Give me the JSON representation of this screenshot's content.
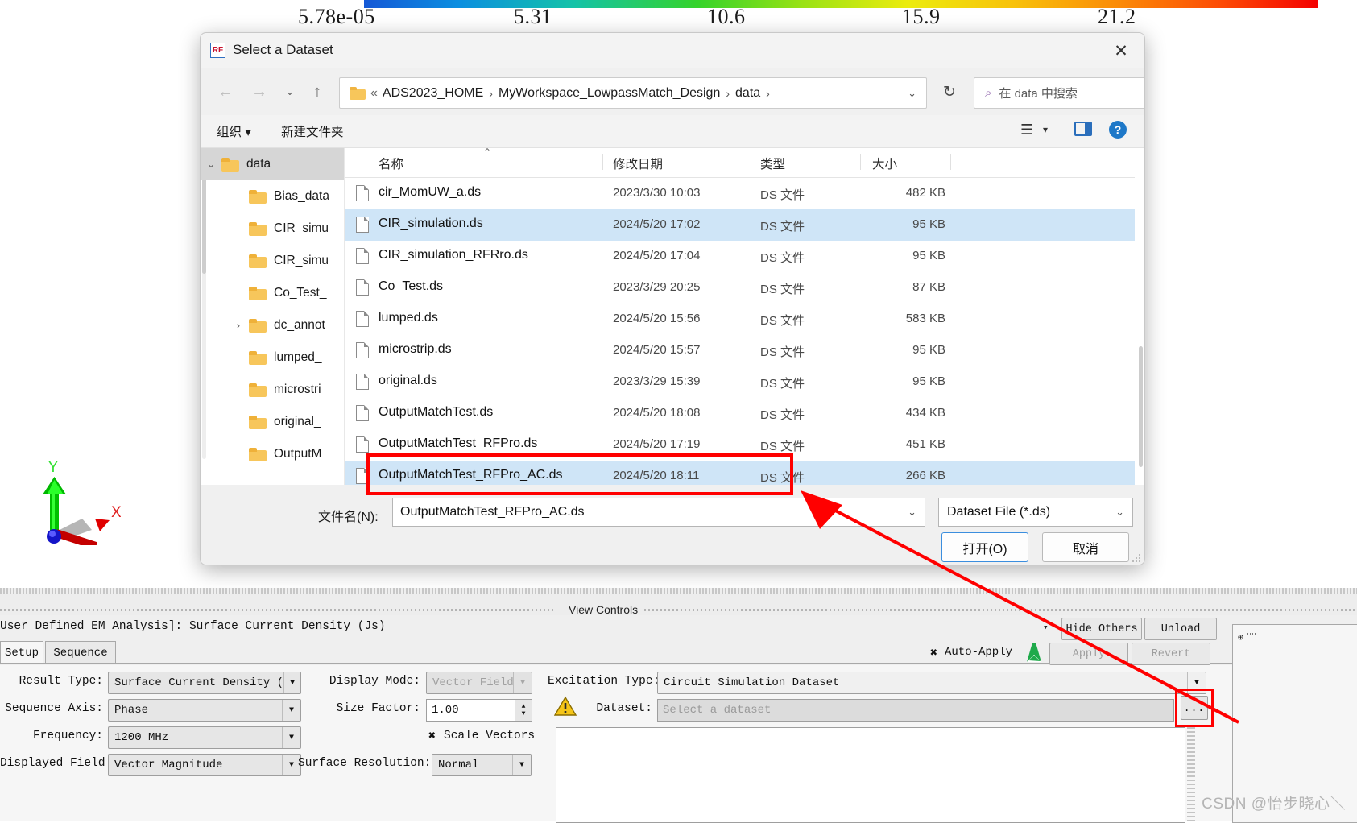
{
  "colorbar": {
    "ticks": [
      "5.78e-05",
      "5.31",
      "10.6",
      "15.9",
      "21.2"
    ]
  },
  "dialog": {
    "title": "Select a Dataset",
    "app_icon_text": "RF",
    "close_label": "✕",
    "nav": {
      "back": "←",
      "forward": "→",
      "recent": "⌄",
      "up": "↑",
      "refresh": "↻"
    },
    "address": {
      "leading": "«",
      "crumbs": [
        "ADS2023_HOME",
        "MyWorkspace_LowpassMatch_Design",
        "data"
      ],
      "separator": "›",
      "chevron": "⌄"
    },
    "search": {
      "placeholder": "在 data 中搜索",
      "icon": "⌕"
    },
    "toolbar": {
      "organize": "组织 ▾",
      "new_folder": "新建文件夹",
      "view_icon": "☰",
      "view_chevron": "▾",
      "help_icon": "?"
    },
    "tree": [
      {
        "label": "data",
        "twisty": "⌄",
        "selected": true,
        "indent": 26
      },
      {
        "label": "Bias_data",
        "twisty": "",
        "selected": false,
        "indent": 60
      },
      {
        "label": "CIR_simu",
        "twisty": "",
        "selected": false,
        "indent": 60
      },
      {
        "label": "CIR_simu",
        "twisty": "",
        "selected": false,
        "indent": 60
      },
      {
        "label": "Co_Test_",
        "twisty": "",
        "selected": false,
        "indent": 60
      },
      {
        "label": "dc_annot",
        "twisty": "›",
        "selected": false,
        "indent": 60
      },
      {
        "label": "lumped_",
        "twisty": "",
        "selected": false,
        "indent": 60
      },
      {
        "label": "microstri",
        "twisty": "",
        "selected": false,
        "indent": 60
      },
      {
        "label": "original_",
        "twisty": "",
        "selected": false,
        "indent": 60
      },
      {
        "label": "OutputM",
        "twisty": "",
        "selected": false,
        "indent": 60
      }
    ],
    "columns": {
      "name": "名称",
      "date": "修改日期",
      "type": "类型",
      "size": "大小",
      "sort_caret": "⌃"
    },
    "files": [
      {
        "name": "cir_MomUW_a.ds",
        "date": "2023/3/30 10:03",
        "type": "DS 文件",
        "size": "482 KB",
        "selected": false
      },
      {
        "name": "CIR_simulation.ds",
        "date": "2024/5/20 17:02",
        "type": "DS 文件",
        "size": "95 KB",
        "selected": true
      },
      {
        "name": "CIR_simulation_RFRro.ds",
        "date": "2024/5/20 17:04",
        "type": "DS 文件",
        "size": "95 KB",
        "selected": false
      },
      {
        "name": "Co_Test.ds",
        "date": "2023/3/29 20:25",
        "type": "DS 文件",
        "size": "87 KB",
        "selected": false
      },
      {
        "name": "lumped.ds",
        "date": "2024/5/20 15:56",
        "type": "DS 文件",
        "size": "583 KB",
        "selected": false
      },
      {
        "name": "microstrip.ds",
        "date": "2024/5/20 15:57",
        "type": "DS 文件",
        "size": "95 KB",
        "selected": false
      },
      {
        "name": "original.ds",
        "date": "2023/3/29 15:39",
        "type": "DS 文件",
        "size": "95 KB",
        "selected": false
      },
      {
        "name": "OutputMatchTest.ds",
        "date": "2024/5/20 18:08",
        "type": "DS 文件",
        "size": "434 KB",
        "selected": false
      },
      {
        "name": "OutputMatchTest_RFPro.ds",
        "date": "2024/5/20 17:19",
        "type": "DS 文件",
        "size": "451 KB",
        "selected": false
      },
      {
        "name": "OutputMatchTest_RFPro_AC.ds",
        "date": "2024/5/20 18:11",
        "type": "DS 文件",
        "size": "266 KB",
        "selected": true
      }
    ],
    "footer": {
      "filename_label": "文件名(N):",
      "filename_value": "OutputMatchTest_RFPro_AC.ds",
      "filetype_value": "Dataset File (*.ds)",
      "chevron": "⌄",
      "open_button": "打开(O)",
      "cancel_button": "取消"
    }
  },
  "bottom_panel": {
    "view_controls_label": "View Controls",
    "analysis_text": "User Defined EM Analysis]: Surface Current Density (Js)",
    "analysis_chevron": "▾",
    "hide_others_button": "Hide Others",
    "unload_button": "Unload",
    "tabs": [
      {
        "label": "Setup",
        "active": true
      },
      {
        "label": "Sequence",
        "active": false
      }
    ],
    "auto_apply_label": "Auto-Apply",
    "auto_apply_mark": "✖",
    "apply_button": "Apply",
    "revert_button": "Revert",
    "fields": {
      "result_type_label": "Result Type:",
      "result_type_value": "Surface Current Density (Js)",
      "sequence_axis_label": "Sequence Axis:",
      "sequence_axis_value": "Phase",
      "frequency_label": "Frequency:",
      "frequency_value": "1200 MHz",
      "displayed_field_label": "Displayed Field:",
      "displayed_field_value": "Vector Magnitude",
      "display_mode_label": "Display Mode:",
      "display_mode_value": "Vector Field",
      "size_factor_label": "Size Factor:",
      "size_factor_value": "1.00",
      "scale_vectors_label": "Scale Vectors",
      "scale_vectors_mark": "✖",
      "surface_resolution_label": "Surface Resolution:",
      "surface_resolution_value": "Normal",
      "excitation_type_label": "Excitation Type:",
      "excitation_type_value": "Circuit Simulation Dataset",
      "dataset_label": "Dataset:",
      "dataset_placeholder": "Select a dataset",
      "dataset_browse_button": "...",
      "warning_icon": "!"
    }
  },
  "axis_gizmo": {
    "y_label": "Y",
    "x_label": "X"
  },
  "watermark": "CSDN @怡步晓心＼"
}
